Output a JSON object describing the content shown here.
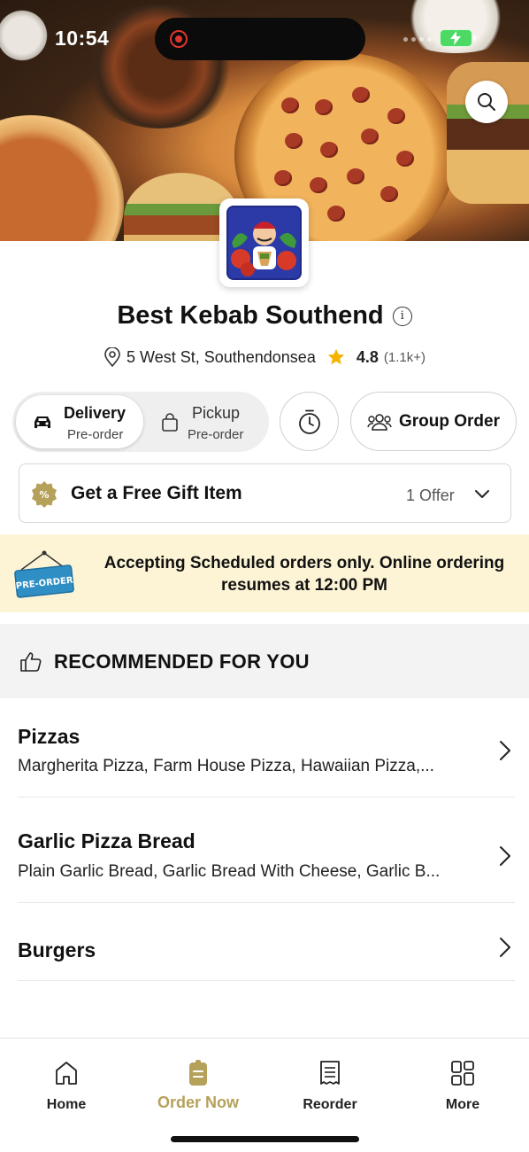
{
  "status_bar": {
    "time": "10:54"
  },
  "restaurant": {
    "name": "Best Kebab Southend",
    "address": "5 West St, Southendonsea",
    "rating": "4.8",
    "rating_count": "(1.1k+)"
  },
  "order_mode": {
    "delivery": {
      "label": "Delivery",
      "sub": "Pre-order",
      "selected": true
    },
    "pickup": {
      "label": "Pickup",
      "sub": "Pre-order"
    },
    "group_order_label": "Group Order"
  },
  "offer": {
    "title": "Get a Free Gift Item",
    "count": "1 Offer"
  },
  "banner": {
    "badge": "PRE-ORDER",
    "message": "Accepting Scheduled orders only. Online ordering resumes at 12:00 PM"
  },
  "recommended": {
    "title": "RECOMMENDED FOR YOU"
  },
  "categories": [
    {
      "name": "Pizzas",
      "items": "Margherita Pizza, Farm House Pizza, Hawaiian Pizza,..."
    },
    {
      "name": "Garlic Pizza Bread",
      "items": "Plain Garlic Bread, Garlic Bread With Cheese, Garlic B..."
    },
    {
      "name": "Burgers",
      "items": ""
    }
  ],
  "tabs": [
    {
      "label": "Home",
      "icon": "home-icon"
    },
    {
      "label": "Order Now",
      "icon": "order-icon",
      "active": true
    },
    {
      "label": "Reorder",
      "icon": "receipt-icon"
    },
    {
      "label": "More",
      "icon": "grid-icon"
    }
  ],
  "colors": {
    "accent": "#b5a15a",
    "banner_bg": "#fdf4d5",
    "star": "#f5b400",
    "recording": "#e0352b"
  }
}
